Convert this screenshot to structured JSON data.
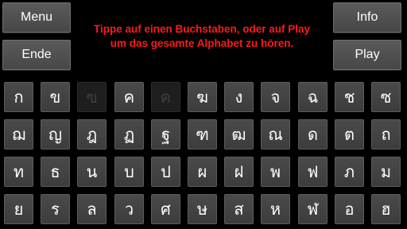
{
  "buttons": {
    "menu": "Menu",
    "end": "Ende",
    "info": "Info",
    "play": "Play"
  },
  "instruction": {
    "line1": "Tippe auf einen Buchstaben, oder auf Play",
    "line2": "um das gesamte Alphabet zu hören."
  },
  "colors": {
    "background": "#000000",
    "instruction_text": "#ff1a1a",
    "key_background": "#444444",
    "key_text": "#ffffff",
    "key_dimmed_text": "#3e3e3e"
  },
  "letters": [
    [
      "ก",
      "ข",
      "ฃ",
      "ค",
      "ฅ",
      "ฆ",
      "ง",
      "จ",
      "ฉ",
      "ช",
      "ซ"
    ],
    [
      "ฌ",
      "ญ",
      "ฎ",
      "ฏ",
      "ฐ",
      "ฑ",
      "ฒ",
      "ณ",
      "ด",
      "ต",
      "ถ"
    ],
    [
      "ท",
      "ธ",
      "น",
      "บ",
      "ป",
      "ผ",
      "ฝ",
      "พ",
      "ฟ",
      "ภ",
      "ม"
    ],
    [
      "ย",
      "ร",
      "ล",
      "ว",
      "ศ",
      "ษ",
      "ส",
      "ห",
      "ฬ",
      "อ",
      "ฮ"
    ]
  ],
  "dimmed_letters": [
    "ฃ",
    "ฅ"
  ]
}
